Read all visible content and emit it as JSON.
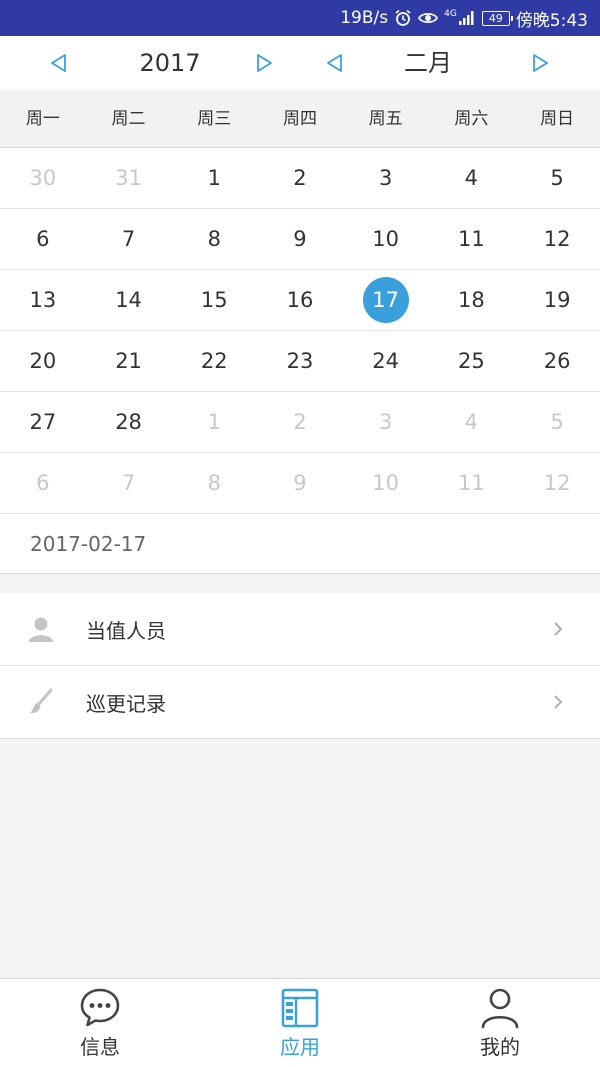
{
  "status_bar": {
    "net_speed": "19B/s",
    "signal_label": "4G",
    "battery": "49",
    "time": "傍晚5:43",
    "bg_color": "#2f3aa5"
  },
  "calendar": {
    "year": "2017",
    "month": "二月",
    "accent_color": "#3aa0dc",
    "weekdays": [
      "周一",
      "周二",
      "周三",
      "周四",
      "周五",
      "周六",
      "周日"
    ],
    "weeks": [
      [
        {
          "d": "30",
          "cur": false
        },
        {
          "d": "31",
          "cur": false
        },
        {
          "d": "1",
          "cur": true
        },
        {
          "d": "2",
          "cur": true
        },
        {
          "d": "3",
          "cur": true
        },
        {
          "d": "4",
          "cur": true
        },
        {
          "d": "5",
          "cur": true
        }
      ],
      [
        {
          "d": "6",
          "cur": true
        },
        {
          "d": "7",
          "cur": true
        },
        {
          "d": "8",
          "cur": true
        },
        {
          "d": "9",
          "cur": true
        },
        {
          "d": "10",
          "cur": true
        },
        {
          "d": "11",
          "cur": true
        },
        {
          "d": "12",
          "cur": true
        }
      ],
      [
        {
          "d": "13",
          "cur": true
        },
        {
          "d": "14",
          "cur": true
        },
        {
          "d": "15",
          "cur": true
        },
        {
          "d": "16",
          "cur": true
        },
        {
          "d": "17",
          "cur": true,
          "sel": true
        },
        {
          "d": "18",
          "cur": true
        },
        {
          "d": "19",
          "cur": true
        }
      ],
      [
        {
          "d": "20",
          "cur": true
        },
        {
          "d": "21",
          "cur": true
        },
        {
          "d": "22",
          "cur": true
        },
        {
          "d": "23",
          "cur": true
        },
        {
          "d": "24",
          "cur": true
        },
        {
          "d": "25",
          "cur": true
        },
        {
          "d": "26",
          "cur": true
        }
      ],
      [
        {
          "d": "27",
          "cur": true
        },
        {
          "d": "28",
          "cur": true
        },
        {
          "d": "1",
          "cur": false
        },
        {
          "d": "2",
          "cur": false
        },
        {
          "d": "3",
          "cur": false
        },
        {
          "d": "4",
          "cur": false
        },
        {
          "d": "5",
          "cur": false
        }
      ],
      [
        {
          "d": "6",
          "cur": false
        },
        {
          "d": "7",
          "cur": false
        },
        {
          "d": "8",
          "cur": false
        },
        {
          "d": "9",
          "cur": false
        },
        {
          "d": "10",
          "cur": false
        },
        {
          "d": "11",
          "cur": false
        },
        {
          "d": "12",
          "cur": false
        }
      ]
    ],
    "selected_date": "2017-02-17"
  },
  "menu": {
    "items": [
      {
        "label": "当值人员",
        "icon": "person-icon"
      },
      {
        "label": "巡更记录",
        "icon": "brush-icon"
      }
    ]
  },
  "tabbar": {
    "tabs": [
      {
        "label": "信息",
        "icon": "chat-bubble-icon",
        "active": false
      },
      {
        "label": "应用",
        "icon": "app-grid-icon",
        "active": true
      },
      {
        "label": "我的",
        "icon": "user-icon",
        "active": false
      }
    ]
  }
}
